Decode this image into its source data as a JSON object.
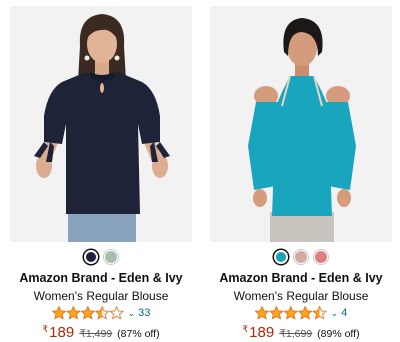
{
  "products": [
    {
      "brand": "Amazon Brand - Eden & Ivy",
      "title": "Women's Regular Blouse",
      "rating": 3.5,
      "review_count": "33",
      "currency": "₹",
      "price": "189",
      "mrp": "₹1,499",
      "discount": "(87% off)",
      "swatches": [
        "#1f2340",
        "#a9bfad"
      ],
      "selected_swatch": 0,
      "garment_color": "#1f2338"
    },
    {
      "brand": "Amazon Brand - Eden & Ivy",
      "title": "Women's Regular Blouse",
      "rating": 4.5,
      "review_count": "4",
      "currency": "₹",
      "price": "189",
      "mrp": "₹1,699",
      "discount": "(89% off)",
      "swatches": [
        "#1aa2b9",
        "#d4aaa5",
        "#e07e84"
      ],
      "selected_swatch": 0,
      "garment_color": "#18a5bd"
    }
  ],
  "colors": {
    "price": "#b12704",
    "star": "#ffa41c",
    "link": "#007185"
  },
  "icons": {
    "star": "star-icon",
    "chevron": "chevron-down-icon"
  }
}
